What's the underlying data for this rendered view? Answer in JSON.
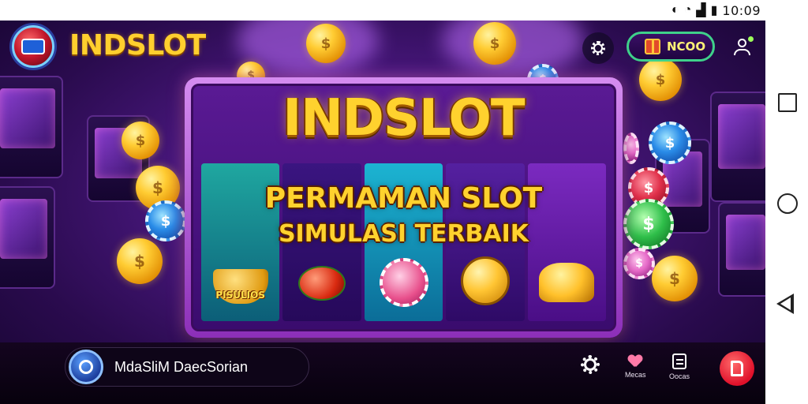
{
  "status": {
    "time": "10:09"
  },
  "header": {
    "brand": "INDSLOT",
    "balance": "NCOO",
    "icons": {
      "settings": "gear-icon",
      "gift": "gift-icon",
      "profile": "user-icon"
    }
  },
  "banner": {
    "title": "INDSLOT",
    "line1": "PERMAMAN SLOT",
    "line2": "SIMULASI  TERBAIK",
    "reel_label": "PISULIOS"
  },
  "bottom": {
    "search_text": "MdaSliM DaecSorian",
    "fav_label": "Mecas",
    "orders_label": "Oocas",
    "icons": {
      "search": "search-icon",
      "settings": "gear-icon",
      "favorite": "heart-icon",
      "orders": "bag-icon",
      "action": "app-icon"
    }
  },
  "colors": {
    "accent": "#ffd22e",
    "balance_border": "#3fd18a",
    "fab": "#e0102a"
  }
}
